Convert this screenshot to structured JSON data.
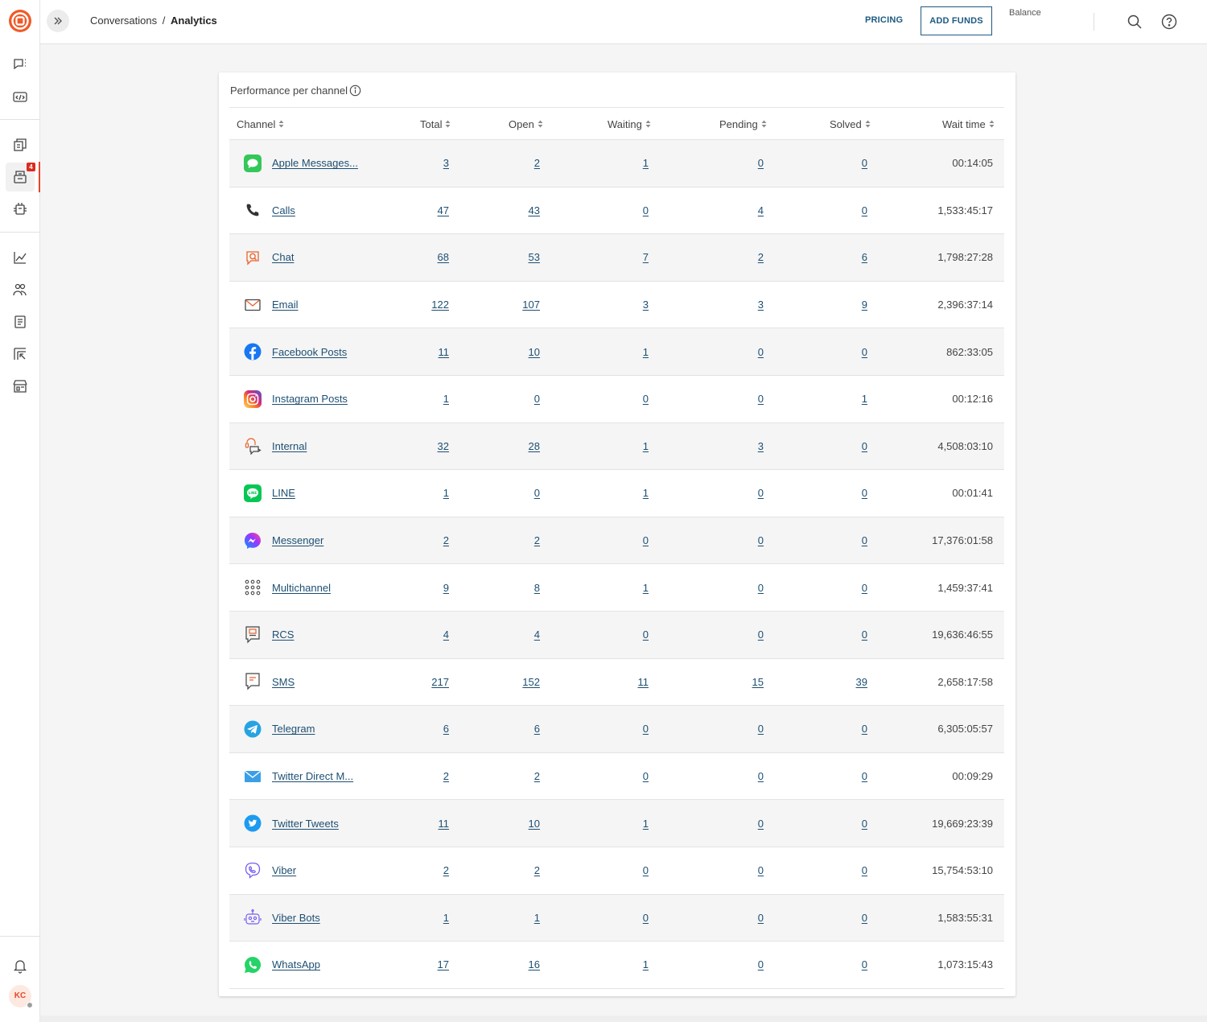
{
  "breadcrumb": {
    "parent": "Conversations",
    "separator": "/",
    "current": "Analytics"
  },
  "header": {
    "pricing_label": "PRICING",
    "add_funds_label": "ADD FUNDS",
    "balance_label": "Balance"
  },
  "sidebar": {
    "badge_count": "4",
    "avatar_initials": "KC",
    "items": [
      "conversations-icon",
      "code-icon",
      "copy-icon",
      "inbox-icon",
      "bot-icon",
      "chart-icon",
      "people-icon",
      "book-icon",
      "cursor-icon",
      "store-icon",
      "bell-icon"
    ]
  },
  "card": {
    "title": "Performance per channel",
    "columns": [
      "Channel",
      "Total",
      "Open",
      "Waiting",
      "Pending",
      "Solved",
      "Wait time"
    ],
    "rows": [
      {
        "channel": "Apple Messages...",
        "icon": "apple-messages-icon",
        "total": "3",
        "open": "2",
        "waiting": "1",
        "pending": "0",
        "solved": "0",
        "wait_time": "00:14:05"
      },
      {
        "channel": "Calls",
        "icon": "phone-icon",
        "total": "47",
        "open": "43",
        "waiting": "0",
        "pending": "4",
        "solved": "0",
        "wait_time": "1,533:45:17"
      },
      {
        "channel": "Chat",
        "icon": "chat-icon",
        "total": "68",
        "open": "53",
        "waiting": "7",
        "pending": "2",
        "solved": "6",
        "wait_time": "1,798:27:28"
      },
      {
        "channel": "Email",
        "icon": "email-icon",
        "total": "122",
        "open": "107",
        "waiting": "3",
        "pending": "3",
        "solved": "9",
        "wait_time": "2,396:37:14"
      },
      {
        "channel": "Facebook Posts",
        "icon": "facebook-icon",
        "total": "11",
        "open": "10",
        "waiting": "1",
        "pending": "0",
        "solved": "0",
        "wait_time": "862:33:05"
      },
      {
        "channel": "Instagram Posts",
        "icon": "instagram-icon",
        "total": "1",
        "open": "0",
        "waiting": "0",
        "pending": "0",
        "solved": "1",
        "wait_time": "00:12:16"
      },
      {
        "channel": "Internal",
        "icon": "internal-icon",
        "total": "32",
        "open": "28",
        "waiting": "1",
        "pending": "3",
        "solved": "0",
        "wait_time": "4,508:03:10"
      },
      {
        "channel": "LINE",
        "icon": "line-icon",
        "total": "1",
        "open": "0",
        "waiting": "1",
        "pending": "0",
        "solved": "0",
        "wait_time": "00:01:41"
      },
      {
        "channel": "Messenger",
        "icon": "messenger-icon",
        "total": "2",
        "open": "2",
        "waiting": "0",
        "pending": "0",
        "solved": "0",
        "wait_time": "17,376:01:58"
      },
      {
        "channel": "Multichannel",
        "icon": "multichannel-icon",
        "total": "9",
        "open": "8",
        "waiting": "1",
        "pending": "0",
        "solved": "0",
        "wait_time": "1,459:37:41"
      },
      {
        "channel": "RCS",
        "icon": "rcs-icon",
        "total": "4",
        "open": "4",
        "waiting": "0",
        "pending": "0",
        "solved": "0",
        "wait_time": "19,636:46:55"
      },
      {
        "channel": "SMS",
        "icon": "sms-icon",
        "total": "217",
        "open": "152",
        "waiting": "11",
        "pending": "15",
        "solved": "39",
        "wait_time": "2,658:17:58"
      },
      {
        "channel": "Telegram",
        "icon": "telegram-icon",
        "total": "6",
        "open": "6",
        "waiting": "0",
        "pending": "0",
        "solved": "0",
        "wait_time": "6,305:05:57"
      },
      {
        "channel": "Twitter Direct M...",
        "icon": "twitter-dm-icon",
        "total": "2",
        "open": "2",
        "waiting": "0",
        "pending": "0",
        "solved": "0",
        "wait_time": "00:09:29"
      },
      {
        "channel": "Twitter Tweets",
        "icon": "twitter-icon",
        "total": "11",
        "open": "10",
        "waiting": "1",
        "pending": "0",
        "solved": "0",
        "wait_time": "19,669:23:39"
      },
      {
        "channel": "Viber",
        "icon": "viber-icon",
        "total": "2",
        "open": "2",
        "waiting": "0",
        "pending": "0",
        "solved": "0",
        "wait_time": "15,754:53:10"
      },
      {
        "channel": "Viber Bots",
        "icon": "viber-bots-icon",
        "total": "1",
        "open": "1",
        "waiting": "0",
        "pending": "0",
        "solved": "0",
        "wait_time": "1,583:55:31"
      },
      {
        "channel": "WhatsApp",
        "icon": "whatsapp-icon",
        "total": "17",
        "open": "16",
        "waiting": "1",
        "pending": "0",
        "solved": "0",
        "wait_time": "1,073:15:43"
      }
    ]
  },
  "colors": {
    "brand": "#e8452c",
    "link": "#1d4f73",
    "accent": "#1d5a82"
  }
}
